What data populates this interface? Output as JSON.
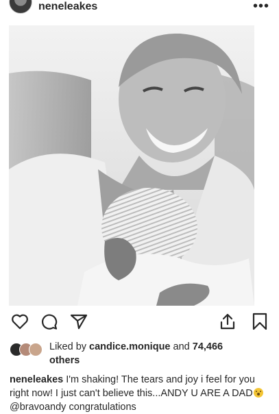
{
  "post": {
    "username": "neneleakes",
    "more_label": "•••"
  },
  "photo": {
    "alt_subject": "man-holding-newborn"
  },
  "actions": {
    "icons": [
      "heart-icon",
      "comment-icon",
      "share-icon",
      "upload-icon",
      "bookmark-icon"
    ]
  },
  "likes": {
    "prefix": "Liked by ",
    "user": "candice.monique",
    "middle": " and ",
    "count": "74,466",
    "suffix": "others"
  },
  "caption": {
    "username": "neneleakes",
    "text_before": " I'm shaking! The tears and joy i feel for you right now! I just can't believe this...ANDY U ARE A DAD",
    "mention": "@bravoandy",
    "text_after": " congratulations"
  }
}
